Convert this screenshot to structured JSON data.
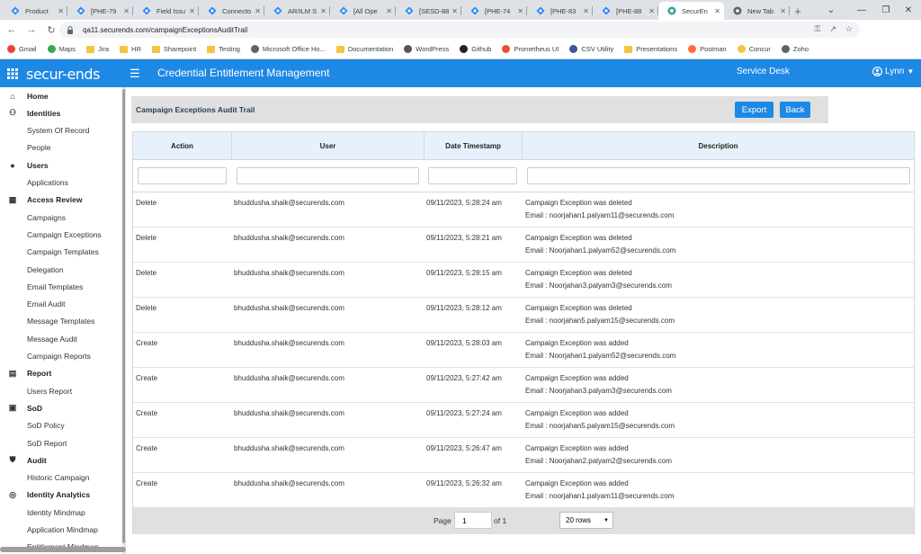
{
  "browser": {
    "tabs": [
      {
        "title": "Product",
        "icon": "jira-icon"
      },
      {
        "title": "[PHE-79",
        "icon": "jira-icon"
      },
      {
        "title": "Field Issu",
        "icon": "jira-icon"
      },
      {
        "title": "Connecto",
        "icon": "jira-icon"
      },
      {
        "title": "AR/ILM S",
        "icon": "jira-icon"
      },
      {
        "title": "[All Ope",
        "icon": "jira-icon"
      },
      {
        "title": "[SESD-88",
        "icon": "jira-icon"
      },
      {
        "title": "[PHE-74",
        "icon": "jira-icon"
      },
      {
        "title": "[PHE-83",
        "icon": "jira-icon"
      },
      {
        "title": "[PHE-88",
        "icon": "jira-icon"
      },
      {
        "title": "SecurEn",
        "icon": "securends-icon",
        "active": true
      },
      {
        "title": "New Tab",
        "icon": "chrome-icon"
      }
    ],
    "url": "qa11.securends.com/campaignExceptionsAuditTrail",
    "bookmarks": [
      {
        "label": "Gmail",
        "icon": "gmail-icon",
        "color": "#ea4335"
      },
      {
        "label": "Maps",
        "icon": "maps-icon",
        "color": "#34a853"
      },
      {
        "label": "Jira",
        "icon": "folder-icon",
        "color": "#f6c344"
      },
      {
        "label": "HR",
        "icon": "folder-icon",
        "color": "#f6c344"
      },
      {
        "label": "Sharepoint",
        "icon": "folder-icon",
        "color": "#f6c344"
      },
      {
        "label": "Testing",
        "icon": "folder-icon",
        "color": "#f6c344"
      },
      {
        "label": "Microsoft Office Ho...",
        "icon": "office-icon",
        "color": "#5f6368"
      },
      {
        "label": "Documentation",
        "icon": "folder-icon",
        "color": "#f6c344"
      },
      {
        "label": "WordPress",
        "icon": "wordpress-icon",
        "color": "#555555"
      },
      {
        "label": "Github",
        "icon": "github-icon",
        "color": "#222222"
      },
      {
        "label": "Prometheus UI",
        "icon": "prometheus-icon",
        "color": "#e6522c"
      },
      {
        "label": "CSV Utility",
        "icon": "csv-icon",
        "color": "#3b5998"
      },
      {
        "label": "Presentations",
        "icon": "folder-icon",
        "color": "#f6c344"
      },
      {
        "label": "Postman",
        "icon": "postman-icon",
        "color": "#ff6c37"
      },
      {
        "label": "Concur",
        "icon": "concur-icon",
        "color": "#f6c344"
      },
      {
        "label": "Zoho",
        "icon": "globe-icon",
        "color": "#5f6368"
      }
    ]
  },
  "header": {
    "logo": "secur-ends",
    "title": "Credential Entitlement Management",
    "service_desk": "Service Desk",
    "user": "Lynn",
    "color": "#1e88e5"
  },
  "sidebar": {
    "items": [
      {
        "label": "Home",
        "type": "section",
        "icon": "home-icon"
      },
      {
        "label": "Identities",
        "type": "section",
        "icon": "people-icon"
      },
      {
        "label": "System Of Record",
        "type": "sub"
      },
      {
        "label": "People",
        "type": "sub"
      },
      {
        "label": "Users",
        "type": "section",
        "icon": "user-icon"
      },
      {
        "label": "Applications",
        "type": "sub"
      },
      {
        "label": "Access Review",
        "type": "section",
        "icon": "grid-icon"
      },
      {
        "label": "Campaigns",
        "type": "sub"
      },
      {
        "label": "Campaign Exceptions",
        "type": "sub"
      },
      {
        "label": "Campaign Templates",
        "type": "sub"
      },
      {
        "label": "Delegation",
        "type": "sub"
      },
      {
        "label": "Email Templates",
        "type": "sub"
      },
      {
        "label": "Email Audit",
        "type": "sub"
      },
      {
        "label": "Message Templates",
        "type": "sub"
      },
      {
        "label": "Message Audit",
        "type": "sub"
      },
      {
        "label": "Campaign Reports",
        "type": "sub"
      },
      {
        "label": "Report",
        "type": "section",
        "icon": "report-icon"
      },
      {
        "label": "Users Report",
        "type": "sub"
      },
      {
        "label": "SoD",
        "type": "section",
        "icon": "sod-icon"
      },
      {
        "label": "SoD Policy",
        "type": "sub"
      },
      {
        "label": "SoD Report",
        "type": "sub"
      },
      {
        "label": "Audit",
        "type": "section",
        "icon": "shield-icon"
      },
      {
        "label": "Historic Campaign",
        "type": "sub"
      },
      {
        "label": "Identity Analytics",
        "type": "section",
        "icon": "analytics-icon"
      },
      {
        "label": "Identity Mindmap",
        "type": "sub"
      },
      {
        "label": "Application Mindmap",
        "type": "sub"
      },
      {
        "label": "Entitlement Mindmap",
        "type": "sub"
      }
    ]
  },
  "panel": {
    "title": "Campaign Exceptions Audit Trail",
    "export_label": "Export",
    "back_label": "Back"
  },
  "table": {
    "columns": [
      "Action",
      "User",
      "Date Timestamp",
      "Description"
    ],
    "rows": [
      {
        "action": "Delete",
        "user": "bhuddusha.shaik@securends.com",
        "date": "09/11/2023, 5:28:24 am",
        "desc1": "Campaign Exception was deleted",
        "desc2": "Email : noorjahan1.palyam11@securends.com"
      },
      {
        "action": "Delete",
        "user": "bhuddusha.shaik@securends.com",
        "date": "09/11/2023, 5:28:21 am",
        "desc1": "Campaign Exception was deleted",
        "desc2": "Email : Noorjahan1.palyam52@securends.com"
      },
      {
        "action": "Delete",
        "user": "bhuddusha.shaik@securends.com",
        "date": "09/11/2023, 5:28:15 am",
        "desc1": "Campaign Exception was deleted",
        "desc2": "Email : Noorjahan3.palyam3@securends.com"
      },
      {
        "action": "Delete",
        "user": "bhuddusha.shaik@securends.com",
        "date": "09/11/2023, 5:28:12 am",
        "desc1": "Campaign Exception was deleted",
        "desc2": "Email : noorjahan5.palyam15@securends.com"
      },
      {
        "action": "Create",
        "user": "bhuddusha.shaik@securends.com",
        "date": "09/11/2023, 5:28:03 am",
        "desc1": "Campaign Exception was added",
        "desc2": "Email : Noorjahan1.palyam52@securends.com"
      },
      {
        "action": "Create",
        "user": "bhuddusha.shaik@securends.com",
        "date": "09/11/2023, 5:27:42 am",
        "desc1": "Campaign Exception was added",
        "desc2": "Email : Noorjahan3.palyam3@securends.com"
      },
      {
        "action": "Create",
        "user": "bhuddusha.shaik@securends.com",
        "date": "09/11/2023, 5:27:24 am",
        "desc1": "Campaign Exception was added",
        "desc2": "Email : noorjahan5.palyam15@securends.com"
      },
      {
        "action": "Create",
        "user": "bhuddusha.shaik@securends.com",
        "date": "09/11/2023, 5:26:47 am",
        "desc1": "Campaign Exception was added",
        "desc2": "Email : Noorjahan2.palyam2@securends.com"
      },
      {
        "action": "Create",
        "user": "bhuddusha.shaik@securends.com",
        "date": "09/11/2023, 5:26:32 am",
        "desc1": "Campaign Exception was added",
        "desc2": "Email : noorjahan1.palyam11@securends.com"
      }
    ]
  },
  "pager": {
    "page_label": "Page",
    "page_value": "1",
    "of_label": "of 1",
    "rows_label": "20 rows"
  }
}
